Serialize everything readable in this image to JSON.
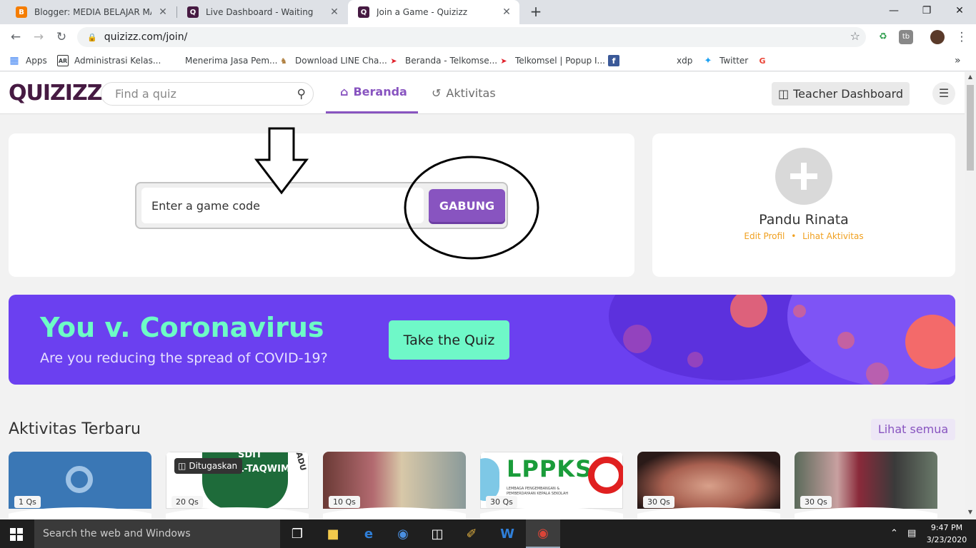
{
  "browser": {
    "tabs": [
      {
        "title": "Blogger: MEDIA BELAJAR MASA BI",
        "favicon_color": "#f57d00",
        "favicon_glyph": "B"
      },
      {
        "title": "Live Dashboard - Waiting",
        "favicon_color": "#461a42",
        "favicon_glyph": "Q"
      },
      {
        "title": "Join a Game - Quizizz",
        "favicon_color": "#461a42",
        "favicon_glyph": "Q"
      }
    ],
    "new_tab_glyph": "+",
    "close_glyph": "✕",
    "window_controls": {
      "minimize": "—",
      "restore": "❐",
      "close": "✕"
    },
    "url": "quizizz.com/join/",
    "bookmarks": [
      {
        "label": "Apps",
        "icon": "apps-grid-icon"
      },
      {
        "label": "Administrasi Kelas...",
        "icon": "ar-icon"
      },
      {
        "label": "Menerima Jasa Pem...",
        "icon": "blank-icon"
      },
      {
        "label": "Download LINE Cha...",
        "icon": "line-icon"
      },
      {
        "label": "Beranda - Telkomse...",
        "icon": "telkomsel-icon"
      },
      {
        "label": "Telkomsel | Popup I...",
        "icon": "telkomsel-icon"
      },
      {
        "label": "",
        "icon": "facebook-icon"
      },
      {
        "label": "xdp",
        "icon": "blank-icon"
      },
      {
        "label": "Twitter",
        "icon": "twitter-icon"
      },
      {
        "label": "",
        "icon": "google-icon"
      }
    ],
    "bookmarks_more": "»"
  },
  "header": {
    "logo": "QUIZIZZ",
    "search_placeholder": "Find a quiz",
    "nav": [
      {
        "label": "Beranda",
        "active": true,
        "icon": "home-icon"
      },
      {
        "label": "Aktivitas",
        "active": false,
        "icon": "history-icon"
      }
    ],
    "teacher_dashboard": "Teacher Dashboard"
  },
  "join": {
    "code_placeholder": "Enter a game code",
    "join_button": "GABUNG"
  },
  "profile": {
    "name": "Pandu Rinata",
    "edit_profile": "Edit Profil",
    "separator": "•",
    "view_activity": "Lihat Aktivitas"
  },
  "banner": {
    "title": "You v. Coronavirus",
    "subtitle": "Are you reducing the spread of COVID-19?",
    "button": "Take the Quiz",
    "colors": {
      "bg": "#6b40f0",
      "title": "#6dfcc6",
      "button": "#6ff8c8",
      "virus": "#f36a6a"
    }
  },
  "recent": {
    "title": "Aktivitas Terbaru",
    "see_all": "Lihat semua",
    "cards": [
      {
        "questions": "1 Qs",
        "assigned": "",
        "theme": "quizizz-logo-blue"
      },
      {
        "questions": "20 Qs",
        "assigned": "Ditugaskan",
        "theme": "school-badge-green",
        "badge_text": "SDIT",
        "badge_text2": "AL-TAQWIM",
        "badge_side": "ADU"
      },
      {
        "questions": "10 Qs",
        "assigned": "",
        "theme": "photo-teachers"
      },
      {
        "questions": "30 Qs",
        "assigned": "",
        "theme": "lppks-logo",
        "logo_text": "LPPKS",
        "logo_sub": "LEMBAGA PENGEMBANGAN & PEMBERDAYAAN KEPALA SEKOLAH"
      },
      {
        "questions": "30 Qs",
        "assigned": "",
        "theme": "photo-hand"
      },
      {
        "questions": "30 Qs",
        "assigned": "",
        "theme": "photo-woman-statue"
      }
    ]
  },
  "taskbar": {
    "search_placeholder": "Search the web and Windows",
    "time": "9:47 PM",
    "date": "3/23/2020"
  },
  "accent_color": "#8854c0"
}
